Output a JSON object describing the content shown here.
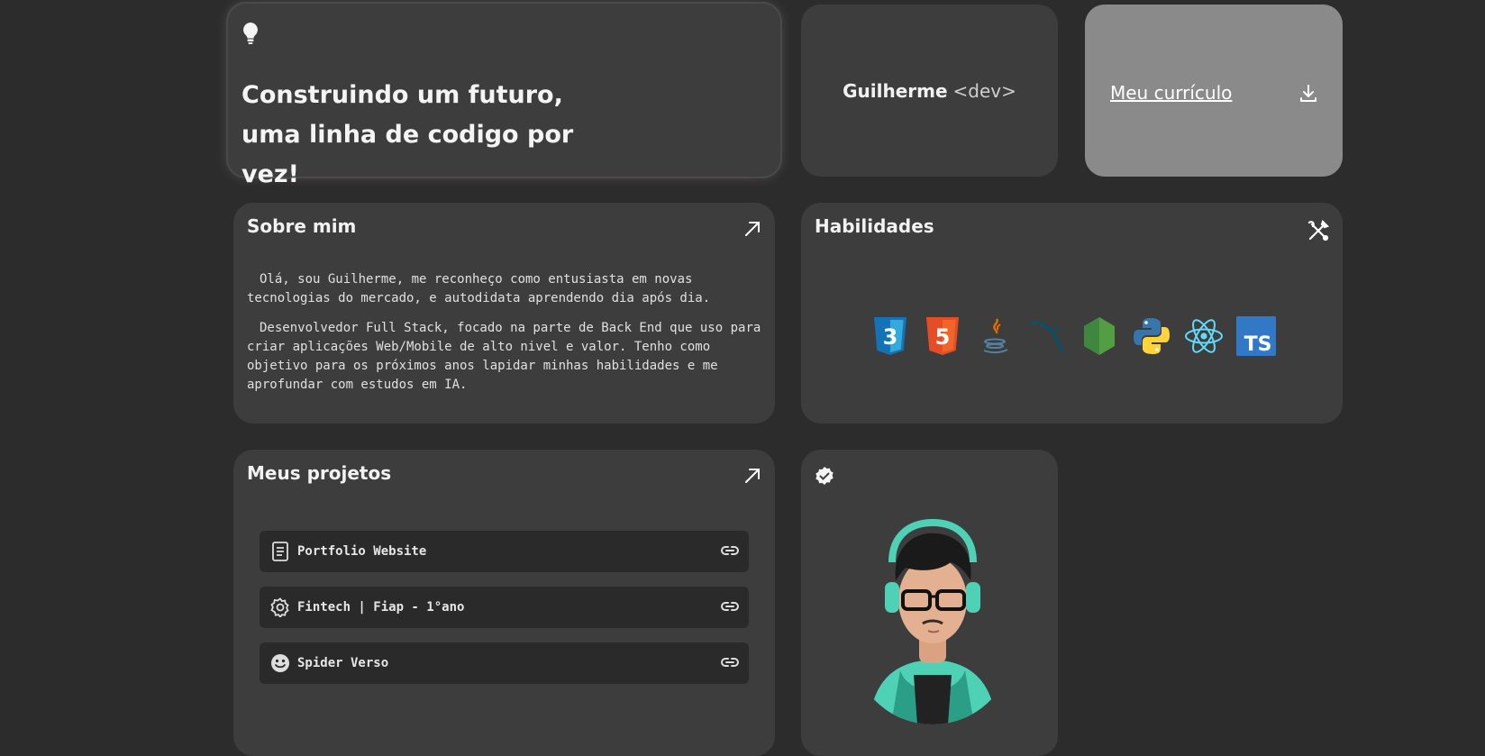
{
  "hero": {
    "icon": "lightbulb-icon",
    "title": "Construindo um futuro, uma linha de codigo por vez!"
  },
  "name_card": {
    "name": "Guilherme",
    "tag": "<dev>"
  },
  "cv_card": {
    "label": "Meu currículo",
    "icon": "download-icon"
  },
  "about": {
    "title": "Sobre mim",
    "icon": "arrow-up-right-icon",
    "paragraphs": [
      "Olá, sou Guilherme, me reconheço como entusiasta em novas tecnologias do mercado, e autodidata aprendendo dia após dia.",
      "Desenvolvedor Full Stack, focado na parte de Back End que uso para criar aplicações Web/Mobile de alto nivel e valor. Tenho como objetivo para os próximos anos lapidar minhas habilidades e me aprofundar com estudos em IA."
    ]
  },
  "skills": {
    "title": "Habilidades",
    "icon": "tools-icon",
    "items": [
      {
        "name": "css3-icon",
        "label": "3",
        "color": "#1572b6"
      },
      {
        "name": "html5-icon",
        "label": "5",
        "color": "#e44d26"
      },
      {
        "name": "java-icon",
        "color": "#e76f00"
      },
      {
        "name": "mysql-icon",
        "color": "#00546b"
      },
      {
        "name": "nodejs-icon",
        "color": "#539e43"
      },
      {
        "name": "python-icon",
        "color": "#3776ab"
      },
      {
        "name": "react-icon",
        "color": "#61dafb"
      },
      {
        "name": "typescript-icon",
        "label": "TS",
        "color": "#3178c6"
      }
    ]
  },
  "projects": {
    "title": "Meus projetos",
    "icon": "arrow-up-right-icon",
    "items": [
      {
        "label": "Portfolio Website",
        "icon": "document-icon"
      },
      {
        "label": "Fintech | Fiap - 1°ano",
        "icon": "gear-icon"
      },
      {
        "label": "Spider Verso",
        "icon": "smiley-icon"
      }
    ]
  },
  "avatar_card": {
    "badge": "verified-badge-icon"
  }
}
